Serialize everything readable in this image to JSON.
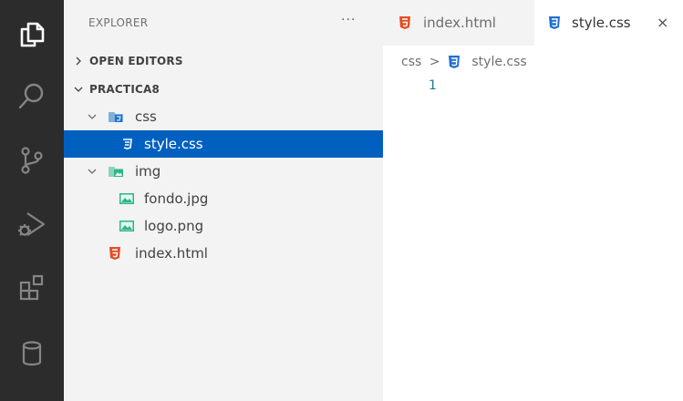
{
  "activity_bar": {
    "icons": [
      "explorer-icon",
      "search-icon",
      "source-control-icon",
      "run-debug-icon",
      "extensions-icon",
      "database-icon"
    ]
  },
  "sidebar": {
    "title": "EXPLORER",
    "more": "···",
    "open_editors": "OPEN EDITORS",
    "project": "PRACTICA8",
    "tree": {
      "css_folder": "css",
      "style_file": "style.css",
      "img_folder": "img",
      "fondo_file": "fondo.jpg",
      "logo_file": "logo.png",
      "index_file": "index.html"
    }
  },
  "editor": {
    "tabs": [
      {
        "label": "index.html",
        "active": false
      },
      {
        "label": "style.css",
        "active": true,
        "close": "×"
      }
    ],
    "breadcrumb": {
      "folder": "css",
      "separator": ">",
      "file": "style.css"
    },
    "line_numbers": [
      "1"
    ]
  },
  "colors": {
    "activity_bar": "#2c2c2c",
    "sidebar": "#f3f3f3",
    "selection": "#0060c0",
    "html_icon": "#e44d26",
    "css_icon": "#1f6fd1",
    "image_icon": "#2bb58a"
  }
}
